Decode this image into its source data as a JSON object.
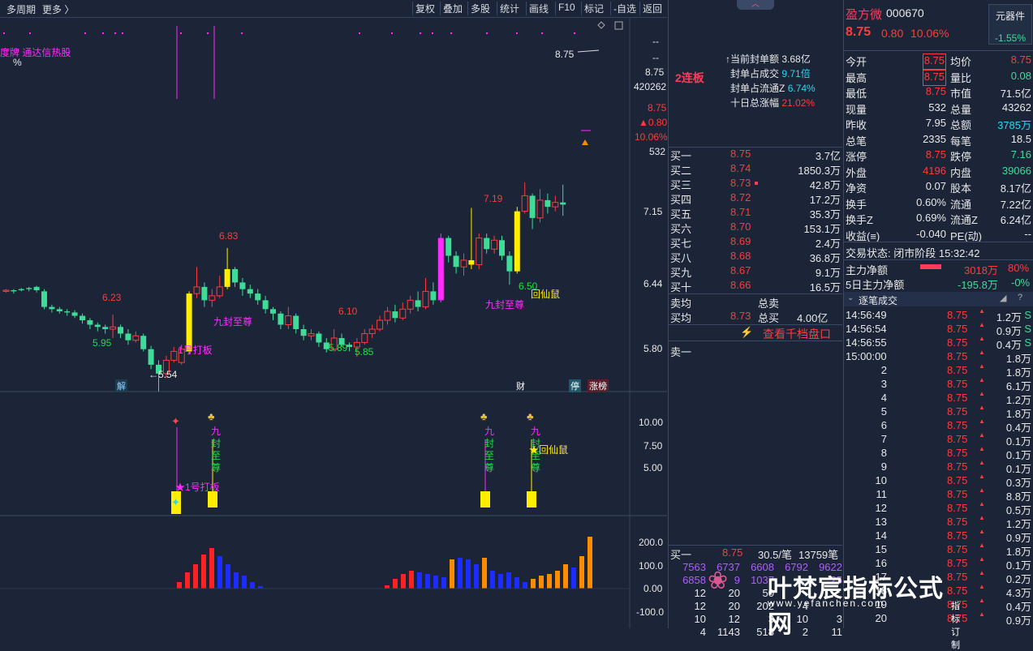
{
  "toolbar": {
    "period": "多周期",
    "more": "更多 〉",
    "buttons": [
      "复权",
      "叠加",
      "多股",
      "统计",
      "画线",
      "F10",
      "标记",
      "-自选",
      "返回"
    ]
  },
  "chart": {
    "top_text": "度牌 通达信热股",
    "percent": "%",
    "price_label": "8.75",
    "side": {
      "a": "--",
      "b": "--",
      "price": "8.75",
      "vol": "420262",
      "price2": "8.75",
      "chg": "▲0.80",
      "pct": "10.06%",
      "cur": "532"
    },
    "y_ticks": [
      "7.15",
      "6.44",
      "5.80"
    ],
    "annotations": {
      "p623": "6.23",
      "p683": "6.83",
      "p610": "6.10",
      "p719": "7.19",
      "p595": "5.95",
      "p589": "5.89",
      "p585": "5.85",
      "p650": "6.50",
      "p554": "←5.54",
      "jiufeng1": "九封至尊",
      "jiufeng2": "九封至尊",
      "huixian": "回仙鼠",
      "dab": "1号打板"
    },
    "events": {
      "jie": "解",
      "cai": "财",
      "ting": "停",
      "zhangbang": "涨榜"
    },
    "sub1": {
      "y_ticks": [
        "10.00",
        "7.50",
        "5.00"
      ],
      "dab": "★1号打板",
      "jiu_chars": [
        "九",
        "封",
        "至",
        "尊"
      ],
      "huixian": "★回仙鼠"
    },
    "sub2": {
      "y_ticks": [
        "200.0",
        "100.0",
        "0.00",
        "-100.0"
      ]
    }
  },
  "mid": {
    "board_title": "2连板",
    "info": [
      {
        "label": "↑当前封单额",
        "value": "3.68亿"
      },
      {
        "label": "封单占成交",
        "value": "9.71倍"
      },
      {
        "label": "封单占流通Z",
        "value": "6.74%"
      },
      {
        "label": "十日总涨幅",
        "value": "21.02%"
      }
    ],
    "bids": [
      {
        "l": "买一",
        "p": "8.75",
        "v": "3.7亿"
      },
      {
        "l": "买二",
        "p": "8.74",
        "v": "1850.3万"
      },
      {
        "l": "买三",
        "p": "8.73",
        "v": "42.8万"
      },
      {
        "l": "买四",
        "p": "8.72",
        "v": "17.2万"
      },
      {
        "l": "买五",
        "p": "8.71",
        "v": "35.3万"
      },
      {
        "l": "买六",
        "p": "8.70",
        "v": "153.1万"
      },
      {
        "l": "买七",
        "p": "8.69",
        "v": "2.4万"
      },
      {
        "l": "买八",
        "p": "8.68",
        "v": "36.8万"
      },
      {
        "l": "买九",
        "p": "8.67",
        "v": "9.1万"
      },
      {
        "l": "买十",
        "p": "8.66",
        "v": "16.5万"
      }
    ],
    "sell_avg_label": "卖均",
    "total_sell_label": "总卖",
    "buy_avg_label": "买均",
    "buy_avg": "8.73",
    "total_buy_label": "总买",
    "total_buy": "4.00亿",
    "view_1000": "查看千档盘口",
    "sell1": "卖一",
    "bottom": {
      "label": "买一",
      "price": "8.75",
      "per": "30.5/笔",
      "count": "13759笔",
      "row1": [
        "7563",
        "6737",
        "6608",
        "6792",
        "9622"
      ],
      "row2": [
        "6858",
        "9",
        "1037",
        "",
        "25"
      ],
      "row3": [
        "12",
        "20",
        "50",
        "",
        ""
      ],
      "row4": [
        "12",
        "20",
        "202",
        "4",
        ""
      ],
      "row5": [
        "10",
        "12",
        "3",
        "10",
        "3"
      ],
      "row6": [
        "4",
        "1143",
        "518",
        "2",
        "11"
      ]
    }
  },
  "right": {
    "name": "盈方微",
    "code": "000670",
    "sector": "元器件",
    "sector_pct": "-1.55%",
    "price": "8.75",
    "chg": "0.80",
    "pct": "10.06%",
    "quotes": [
      {
        "a": "今开",
        "av": "8.75",
        "b": "均价",
        "bv": "8.75"
      },
      {
        "a": "最高",
        "av": "8.75",
        "b": "量比",
        "bv": "0.08"
      },
      {
        "a": "最低",
        "av": "8.75",
        "b": "市值",
        "bv": "71.5亿"
      },
      {
        "a": "现量",
        "av": "532",
        "b": "总量",
        "bv": "43262"
      },
      {
        "a": "昨收",
        "av": "7.95",
        "b": "总额",
        "bv": "3785万"
      },
      {
        "a": "总笔",
        "av": "2335",
        "b": "每笔",
        "bv": "18.5"
      },
      {
        "a": "涨停",
        "av": "8.75",
        "b": "跌停",
        "bv": "7.16"
      },
      {
        "a": "外盘",
        "av": "4196",
        "b": "内盘",
        "bv": "39066"
      },
      {
        "a": "净资",
        "av": "0.07",
        "b": "股本",
        "bv": "8.17亿"
      },
      {
        "a": "换手",
        "av": "0.60%",
        "b": "流通",
        "bv": "7.22亿"
      },
      {
        "a": "换手Z",
        "av": "0.69%",
        "b": "流通Z",
        "bv": "6.24亿"
      },
      {
        "a": "收益(≡)",
        "av": "-0.040",
        "b": "PE(动)",
        "bv": "--"
      }
    ],
    "trade_state": "交易状态: 闭市阶段 15:32:42",
    "main_net_label": "主力净额",
    "main_net": "3018万",
    "main_net_pct": "80%",
    "main5_label": "5日主力净额",
    "main5": "-195.8万",
    "main5_pct": "-0%",
    "ticks_title": "逐笔成交",
    "ticks": [
      {
        "t": "14:56:49",
        "p": "8.75",
        "v": "1.2万",
        "f": "S"
      },
      {
        "t": "14:56:54",
        "p": "8.75",
        "v": "0.9万",
        "f": "S"
      },
      {
        "t": "14:56:55",
        "p": "8.75",
        "v": "0.4万",
        "f": "S"
      },
      {
        "t": "15:00:00",
        "p": "8.75",
        "v": "1.8万",
        "f": ""
      },
      {
        "t": "2",
        "p": "8.75",
        "v": "1.8万",
        "f": ""
      },
      {
        "t": "3",
        "p": "8.75",
        "v": "6.1万",
        "f": ""
      },
      {
        "t": "4",
        "p": "8.75",
        "v": "1.2万",
        "f": ""
      },
      {
        "t": "5",
        "p": "8.75",
        "v": "1.8万",
        "f": ""
      },
      {
        "t": "6",
        "p": "8.75",
        "v": "0.4万",
        "f": ""
      },
      {
        "t": "7",
        "p": "8.75",
        "v": "0.1万",
        "f": ""
      },
      {
        "t": "8",
        "p": "8.75",
        "v": "0.1万",
        "f": ""
      },
      {
        "t": "9",
        "p": "8.75",
        "v": "0.1万",
        "f": ""
      },
      {
        "t": "10",
        "p": "8.75",
        "v": "0.3万",
        "f": ""
      },
      {
        "t": "11",
        "p": "8.75",
        "v": "8.8万",
        "f": ""
      },
      {
        "t": "12",
        "p": "8.75",
        "v": "0.5万",
        "f": ""
      },
      {
        "t": "13",
        "p": "8.75",
        "v": "1.2万",
        "f": ""
      },
      {
        "t": "14",
        "p": "8.75",
        "v": "0.9万",
        "f": ""
      },
      {
        "t": "15",
        "p": "8.75",
        "v": "1.8万",
        "f": ""
      },
      {
        "t": "16",
        "p": "8.75",
        "v": "0.1万",
        "f": ""
      },
      {
        "t": "17",
        "p": "8.75",
        "v": "0.2万",
        "f": ""
      },
      {
        "t": "18",
        "p": "8.75",
        "v": "4.3万",
        "f": ""
      },
      {
        "t": "19",
        "p": "8.75",
        "v": "0.4万",
        "f": ""
      },
      {
        "t": "20",
        "p": "8.75",
        "v": "0.9万",
        "f": ""
      }
    ]
  },
  "watermark": {
    "title": "叶梵宸指标公式网",
    "url": "www.yefanchen.com",
    "sub": "指 标 订 制"
  },
  "colors": {
    "up": "#ff3b3b",
    "down": "#3ddc97",
    "bg": "#1b2537",
    "accent": "#ffee00"
  }
}
